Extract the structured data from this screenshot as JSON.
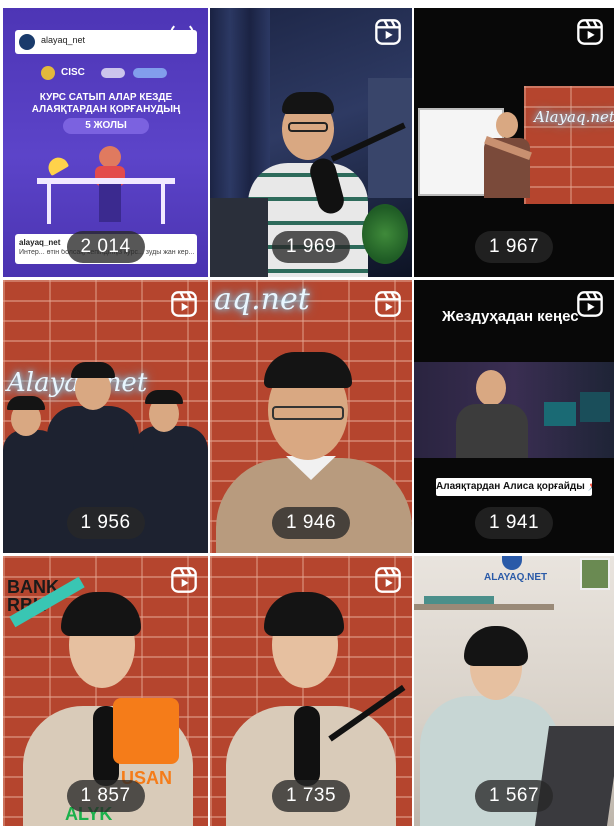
{
  "tiles": [
    {
      "views": "2 014",
      "kind": "post",
      "account_name": "alayaq_net",
      "poster_title": "КУРС САТЫП АЛАР КЕЗДЕ АЛАЯҚТАРДАН ҚОРҒАНУДЫҢ",
      "poster_badge": "5 ЖОЛЫ",
      "logo_cisc": "CISC",
      "caption_account": "alayaq_net",
      "caption_text": "Интер... өтін болсақ, кепілдігіңіз курс... зуды жан кер..."
    },
    {
      "views": "1 969",
      "kind": "reel"
    },
    {
      "views": "1 967",
      "kind": "reel",
      "neon": "Alayaq.net"
    },
    {
      "views": "1 956",
      "kind": "reel",
      "neon": "Alayaq.net"
    },
    {
      "views": "1 946",
      "kind": "reel",
      "neon": "aq.net"
    },
    {
      "views": "1 941",
      "kind": "reel",
      "top_text": "Жездуҳадан кеңес",
      "bottom_text": "Алаяқтардан Алиса қорғайды 📌"
    },
    {
      "views": "1 857",
      "kind": "reel",
      "brand1": "BANK RBK",
      "brand2": "USAN",
      "brand3": "ALYK"
    },
    {
      "views": "1 735",
      "kind": "reel"
    },
    {
      "views": "1 567",
      "kind": "reel",
      "sign": "ALAYAQ.NET"
    }
  ],
  "icons": {
    "reel": "reels-icon"
  },
  "colors": {
    "badge_bg": "#2b2b2b",
    "purple": "#4d35b5",
    "brick": "#b5452e"
  }
}
